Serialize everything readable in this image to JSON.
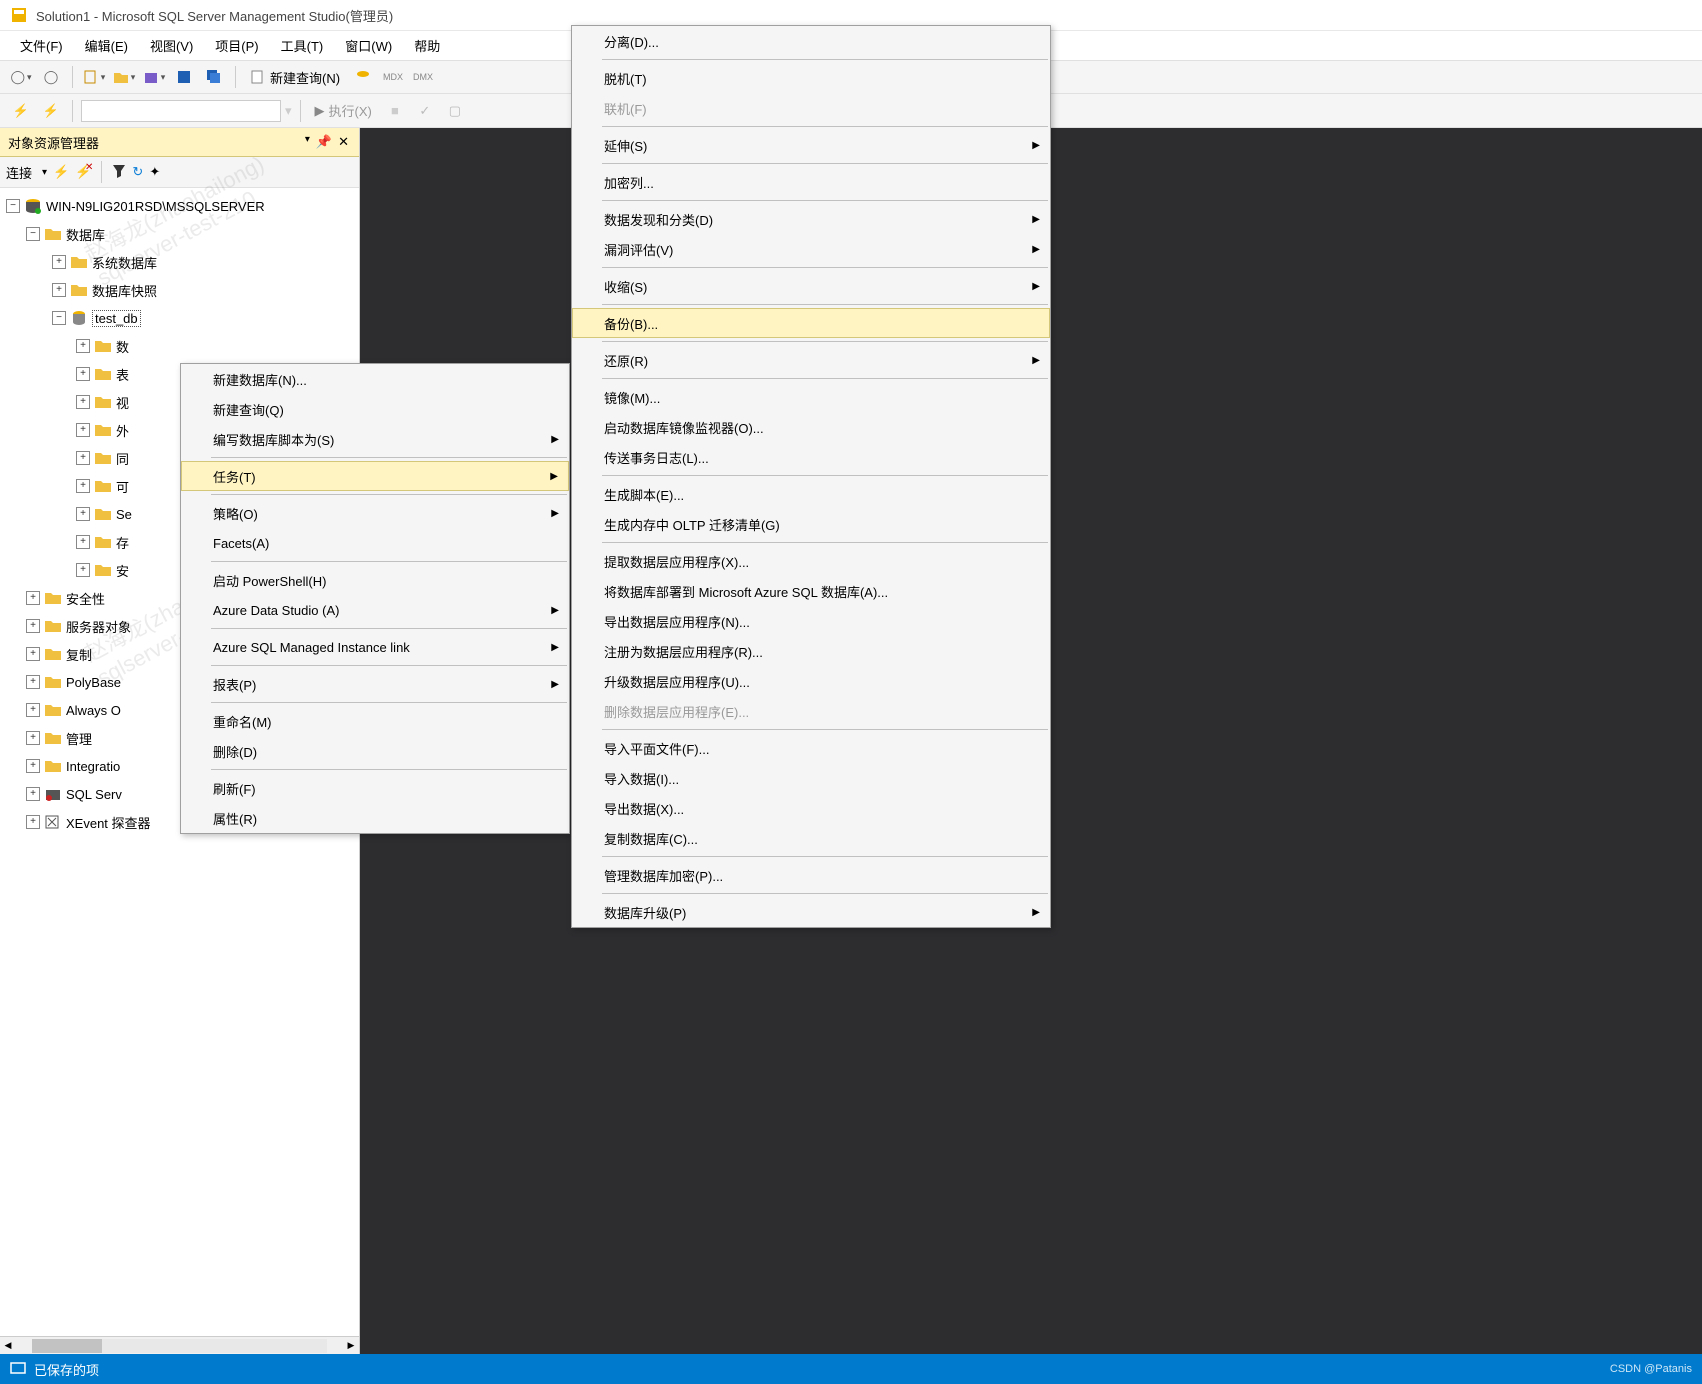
{
  "title": "Solution1 - Microsoft SQL Server Management Studio(管理员)",
  "menubar": [
    "文件(F)",
    "编辑(E)",
    "视图(V)",
    "项目(P)",
    "工具(T)",
    "窗口(W)",
    "帮助"
  ],
  "toolbar": {
    "new_query": "新建查询(N)",
    "execute": "执行(X)"
  },
  "object_explorer": {
    "title": "对象资源管理器",
    "connect_label": "连接",
    "server": "WIN-N9LIG201RSD\\MSSQLSERVER",
    "nodes": {
      "databases": "数据库",
      "system_db": "系统数据库",
      "db_snapshot": "数据库快照",
      "test_db": "test_db",
      "sub": [
        "数",
        "表",
        "视",
        "外",
        "同",
        "可",
        "Se",
        "存",
        "安"
      ],
      "security": "安全性",
      "server_obj": "服务器对象",
      "replication": "复制",
      "polybase": "PolyBase",
      "always": "Always O",
      "management": "管理",
      "integration": "Integratio",
      "sql_serv": "SQL Serv",
      "xevent": "XEvent 探查器"
    }
  },
  "context_menu1": [
    {
      "label": "新建数据库(N)...",
      "type": "item"
    },
    {
      "label": "新建查询(Q)",
      "type": "item"
    },
    {
      "label": "编写数据库脚本为(S)",
      "type": "submenu"
    },
    {
      "type": "sep"
    },
    {
      "label": "任务(T)",
      "type": "submenu",
      "highlighted": true
    },
    {
      "type": "sep"
    },
    {
      "label": "策略(O)",
      "type": "submenu"
    },
    {
      "label": "Facets(A)",
      "type": "item"
    },
    {
      "type": "sep"
    },
    {
      "label": "启动 PowerShell(H)",
      "type": "item"
    },
    {
      "label": "Azure Data Studio (A)",
      "type": "submenu"
    },
    {
      "type": "sep"
    },
    {
      "label": "Azure SQL Managed Instance link",
      "type": "submenu"
    },
    {
      "type": "sep"
    },
    {
      "label": "报表(P)",
      "type": "submenu"
    },
    {
      "type": "sep"
    },
    {
      "label": "重命名(M)",
      "type": "item"
    },
    {
      "label": "删除(D)",
      "type": "item"
    },
    {
      "type": "sep"
    },
    {
      "label": "刷新(F)",
      "type": "item"
    },
    {
      "label": "属性(R)",
      "type": "item"
    }
  ],
  "context_menu2": [
    {
      "label": "分离(D)...",
      "type": "item"
    },
    {
      "type": "sep"
    },
    {
      "label": "脱机(T)",
      "type": "item"
    },
    {
      "label": "联机(F)",
      "type": "item",
      "disabled": true
    },
    {
      "type": "sep"
    },
    {
      "label": "延伸(S)",
      "type": "submenu"
    },
    {
      "type": "sep"
    },
    {
      "label": "加密列...",
      "type": "item"
    },
    {
      "type": "sep"
    },
    {
      "label": "数据发现和分类(D)",
      "type": "submenu"
    },
    {
      "label": "漏洞评估(V)",
      "type": "submenu"
    },
    {
      "type": "sep"
    },
    {
      "label": "收缩(S)",
      "type": "submenu"
    },
    {
      "type": "sep"
    },
    {
      "label": "备份(B)...",
      "type": "item",
      "highlighted": true
    },
    {
      "type": "sep"
    },
    {
      "label": "还原(R)",
      "type": "submenu"
    },
    {
      "type": "sep"
    },
    {
      "label": "镜像(M)...",
      "type": "item"
    },
    {
      "label": "启动数据库镜像监视器(O)...",
      "type": "item"
    },
    {
      "label": "传送事务日志(L)...",
      "type": "item"
    },
    {
      "type": "sep"
    },
    {
      "label": "生成脚本(E)...",
      "type": "item"
    },
    {
      "label": "生成内存中 OLTP 迁移清单(G)",
      "type": "item"
    },
    {
      "type": "sep"
    },
    {
      "label": "提取数据层应用程序(X)...",
      "type": "item"
    },
    {
      "label": "将数据库部署到 Microsoft Azure SQL 数据库(A)...",
      "type": "item"
    },
    {
      "label": "导出数据层应用程序(N)...",
      "type": "item"
    },
    {
      "label": "注册为数据层应用程序(R)...",
      "type": "item"
    },
    {
      "label": "升级数据层应用程序(U)...",
      "type": "item"
    },
    {
      "label": "删除数据层应用程序(E)...",
      "type": "item",
      "disabled": true
    },
    {
      "type": "sep"
    },
    {
      "label": "导入平面文件(F)...",
      "type": "item"
    },
    {
      "label": "导入数据(I)...",
      "type": "item"
    },
    {
      "label": "导出数据(X)...",
      "type": "item"
    },
    {
      "label": "复制数据库(C)...",
      "type": "item"
    },
    {
      "type": "sep"
    },
    {
      "label": "管理数据库加密(P)...",
      "type": "item"
    },
    {
      "type": "sep"
    },
    {
      "label": "数据库升级(P)",
      "type": "submenu"
    }
  ],
  "statusbar": {
    "saved": "已保存的项",
    "credit": "CSDN @Patanis"
  },
  "watermark": "赵海龙(zhaohailong)\nsqlserver-test-210"
}
